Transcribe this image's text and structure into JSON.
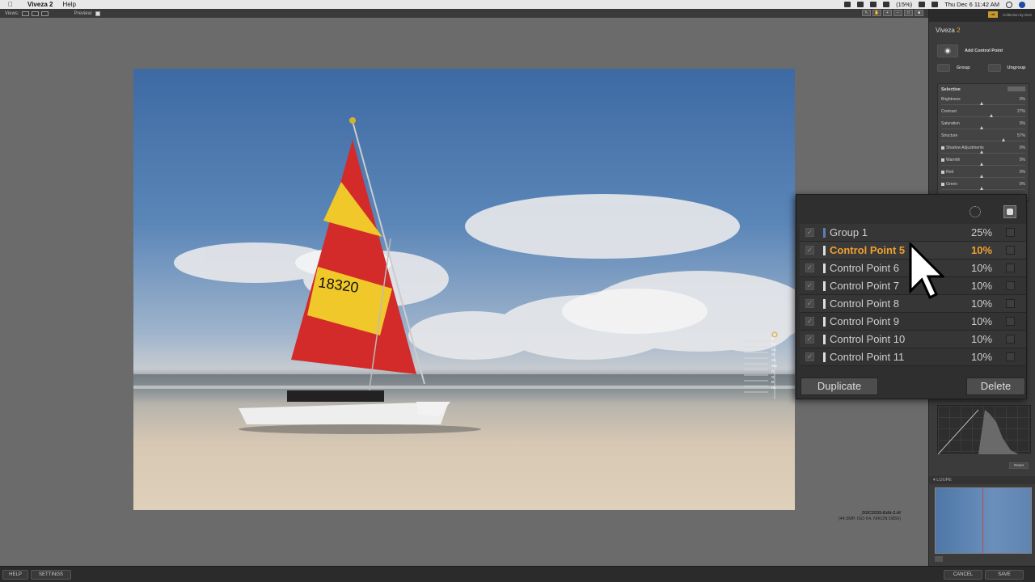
{
  "menubar": {
    "app_name": "Viveza 2",
    "help": "Help",
    "battery": "(15%)",
    "clock": "Thu Dec 6  11:42 AM"
  },
  "toolbar": {
    "views_label": "Views:",
    "preview_label": "Preview:"
  },
  "file": {
    "name": "_DSC2535-Edit-2.tif",
    "meta": "(44.5MP, ISO 64, NIKON D850)"
  },
  "panel": {
    "brand": "Collection by DxO",
    "title_main": "Viveza",
    "title_version": "2",
    "add_control_point": "Add Control Point",
    "group": "Group",
    "ungroup": "Ungroup",
    "selective_title": "Selective",
    "sliders": [
      {
        "name": "Brightness",
        "value": "0%",
        "level": 0.5
      },
      {
        "name": "Contrast",
        "value": "27%",
        "level": 0.63
      },
      {
        "name": "Saturation",
        "value": "0%",
        "level": 0.5
      },
      {
        "name": "Structure",
        "value": "57%",
        "level": 0.78
      },
      {
        "name": "Shadow Adjustments",
        "value": "0%",
        "level": 0.5
      },
      {
        "name": "Warmth",
        "value": "0%",
        "level": 0.5
      },
      {
        "name": "Red",
        "value": "0%",
        "level": 0.5
      },
      {
        "name": "Green",
        "value": "0%",
        "level": 0.5
      }
    ],
    "reset": "Reset",
    "loupe": "LOUPE"
  },
  "control_points": {
    "rows": [
      {
        "name": "Group 1",
        "value": "25%",
        "selected": false,
        "group": true
      },
      {
        "name": "Control Point 5",
        "value": "10%",
        "selected": true,
        "group": false
      },
      {
        "name": "Control Point 6",
        "value": "10%",
        "selected": false,
        "group": false
      },
      {
        "name": "Control Point 7",
        "value": "10%",
        "selected": false,
        "group": false
      },
      {
        "name": "Control Point 8",
        "value": "10%",
        "selected": false,
        "group": false
      },
      {
        "name": "Control Point 9",
        "value": "10%",
        "selected": false,
        "group": false
      },
      {
        "name": "Control Point 10",
        "value": "10%",
        "selected": false,
        "group": false
      },
      {
        "name": "Control Point 11",
        "value": "10%",
        "selected": false,
        "group": false
      }
    ],
    "duplicate": "Duplicate",
    "delete": "Delete",
    "check_mark": "✓"
  },
  "cp_widget_labels": [
    "Br",
    "Co",
    "Sa",
    "St",
    "Sh",
    "Wa",
    "R",
    "G",
    "B",
    "Hu"
  ],
  "sail_number": "18320",
  "bottombar": {
    "help": "HELP",
    "settings": "SETTINGS",
    "cancel": "CANCEL",
    "save": "SAVE"
  },
  "colors": {
    "accent": "#f0a030",
    "panel_bg": "#3b3b3b",
    "canvas_bg": "#6b6b6b"
  }
}
